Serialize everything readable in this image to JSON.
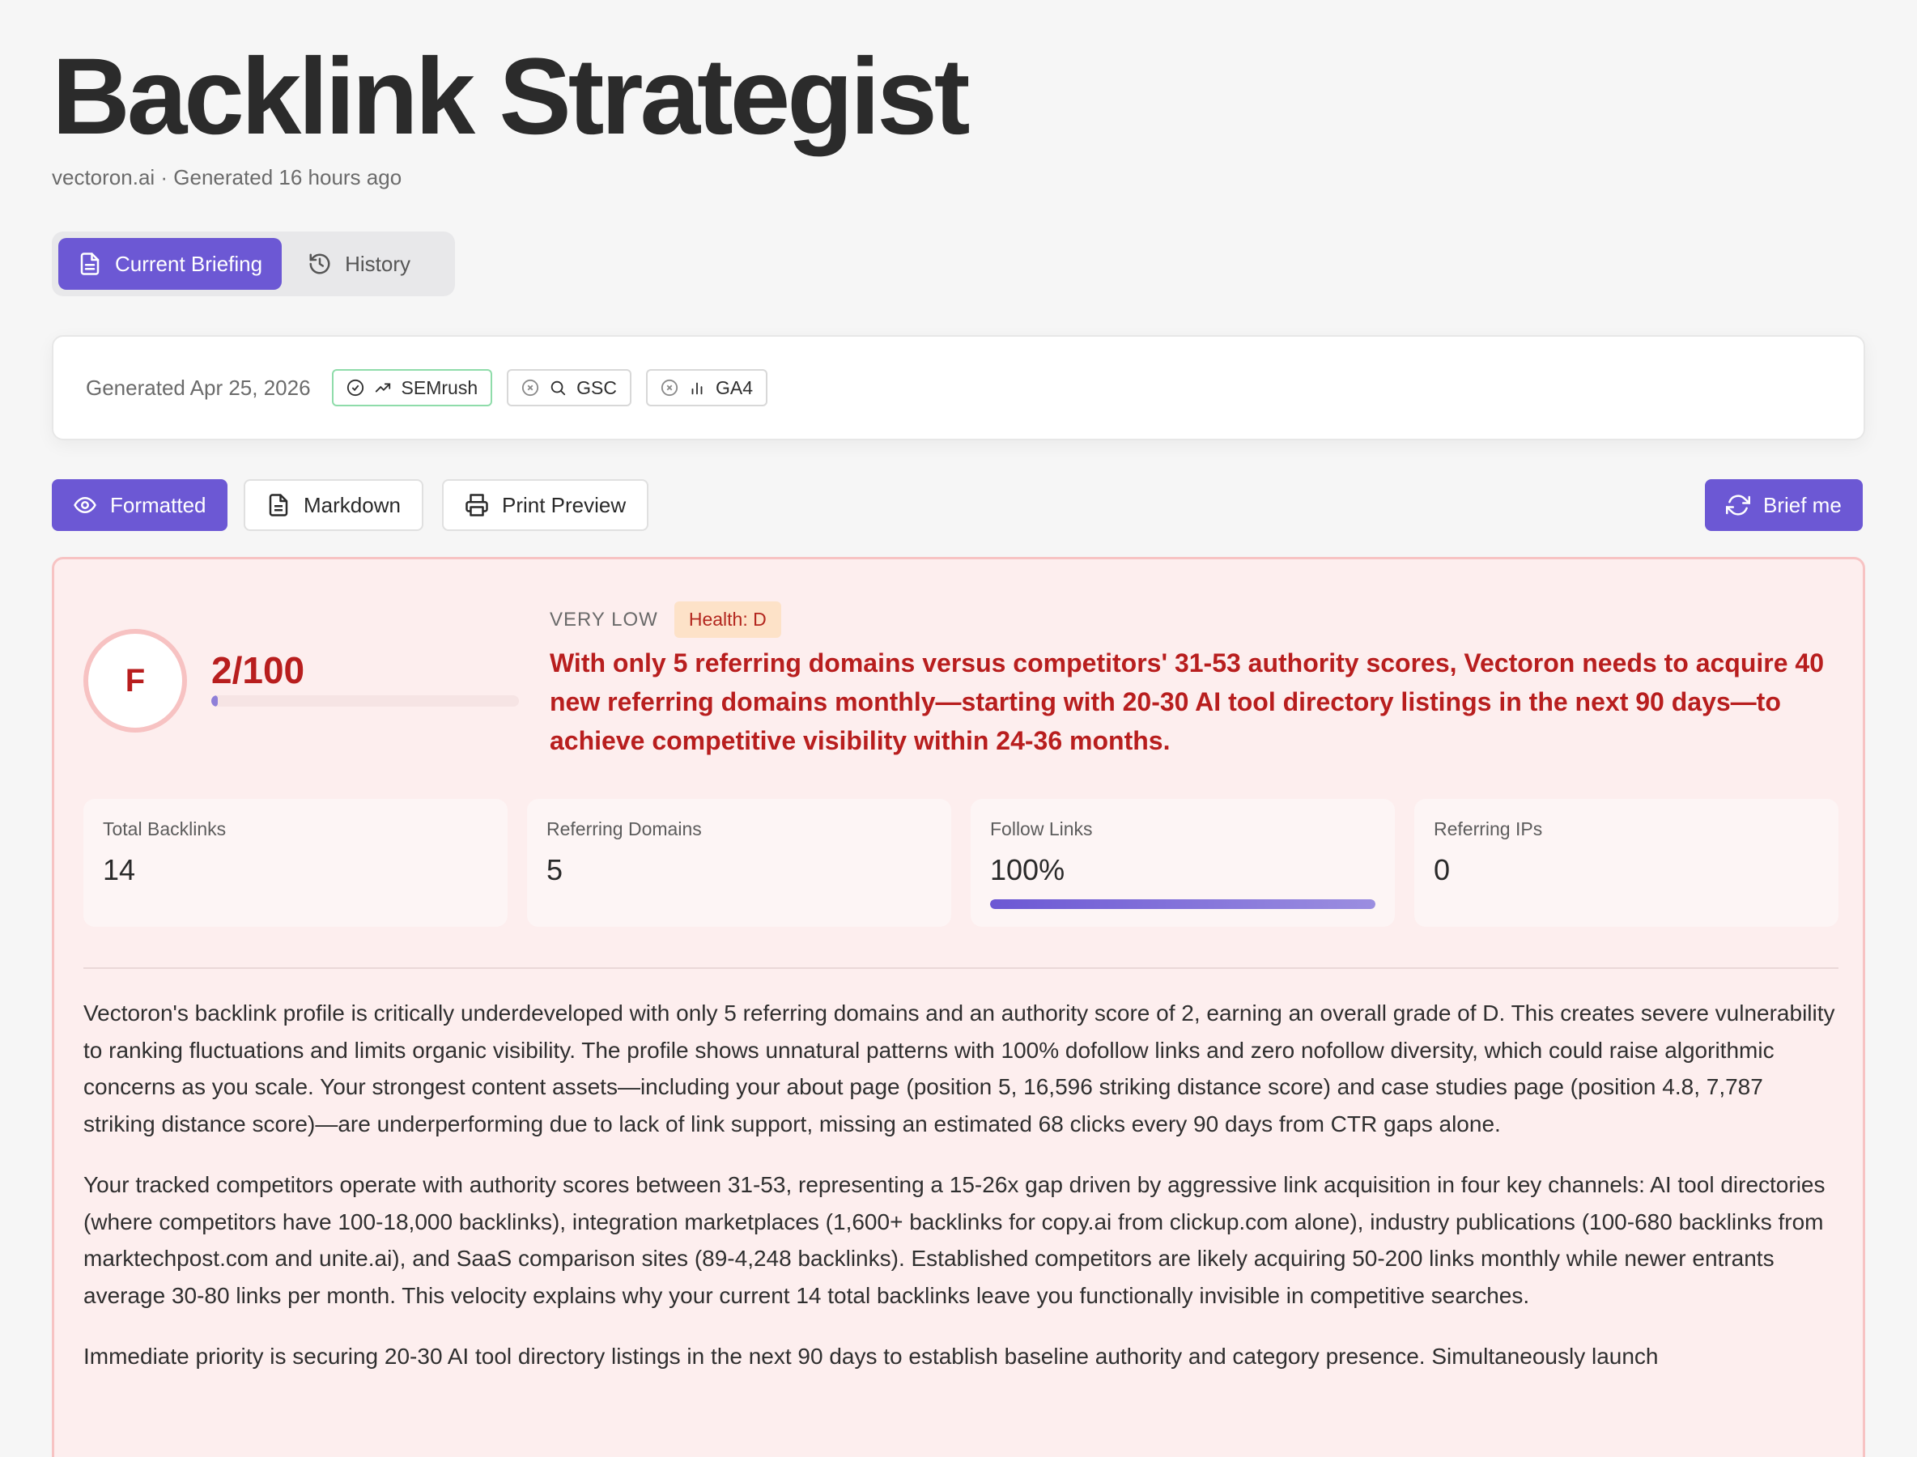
{
  "header": {
    "title": "Backlink Strategist",
    "subtitle": "vectoron.ai · Generated 16 hours ago"
  },
  "tabs": [
    {
      "label": "Current Briefing",
      "icon": "document-icon",
      "active": true
    },
    {
      "label": "History",
      "icon": "history-icon",
      "active": false
    }
  ],
  "sources": {
    "generated": "Generated Apr 25, 2026",
    "chips": [
      {
        "label": "SEMrush",
        "status": "connected",
        "icon": "trending-up-icon"
      },
      {
        "label": "GSC",
        "status": "disconnected",
        "icon": "search-icon"
      },
      {
        "label": "GA4",
        "status": "disconnected",
        "icon": "bar-chart-icon"
      }
    ]
  },
  "toolbar": {
    "formatted": "Formatted",
    "markdown": "Markdown",
    "print_preview": "Print Preview",
    "brief_me": "Brief me"
  },
  "report": {
    "grade": "F",
    "score": "2/100",
    "score_fraction": 0.02,
    "level": "VERY LOW",
    "health": "Health: D",
    "headline": "With only 5 referring domains versus competitors' 31-53 authority scores, Vectoron needs to acquire 40 new referring domains monthly—starting with 20-30 AI tool directory listings in the next 90 days—to achieve competitive visibility within 24-36 months.",
    "stats": [
      {
        "label": "Total Backlinks",
        "value": "14"
      },
      {
        "label": "Referring Domains",
        "value": "5"
      },
      {
        "label": "Follow Links",
        "value": "100%",
        "fraction": 1.0
      },
      {
        "label": "Referring IPs",
        "value": "0"
      }
    ],
    "paragraphs": [
      "Vectoron's backlink profile is critically underdeveloped with only 5 referring domains and an authority score of 2, earning an overall grade of D. This creates severe vulnerability to ranking fluctuations and limits organic visibility. The profile shows unnatural patterns with 100% dofollow links and zero nofollow diversity, which could raise algorithmic concerns as you scale. Your strongest content assets—including your about page (position 5, 16,596 striking distance score) and case studies page (position 4.8, 7,787 striking distance score)—are underperforming due to lack of link support, missing an estimated 68 clicks every 90 days from CTR gaps alone.",
      "Your tracked competitors operate with authority scores between 31-53, representing a 15-26x gap driven by aggressive link acquisition in four key channels: AI tool directories (where competitors have 100-18,000 backlinks), integration marketplaces (1,600+ backlinks for copy.ai from clickup.com alone), industry publications (100-680 backlinks from marktechpost.com and unite.ai), and SaaS comparison sites (89-4,248 backlinks). Established competitors are likely acquiring 50-200 links monthly while newer entrants average 30-80 links per month. This velocity explains why your current 14 total backlinks leave you functionally invisible in competitive searches.",
      "Immediate priority is securing 20-30 AI tool directory listings in the next 90 days to establish baseline authority and category presence. Simultaneously launch"
    ]
  },
  "colors": {
    "accent": "#6c58d4",
    "danger": "#b81e1e",
    "report_bg": "#fdeeee",
    "ok_border": "#8fdcaa"
  }
}
